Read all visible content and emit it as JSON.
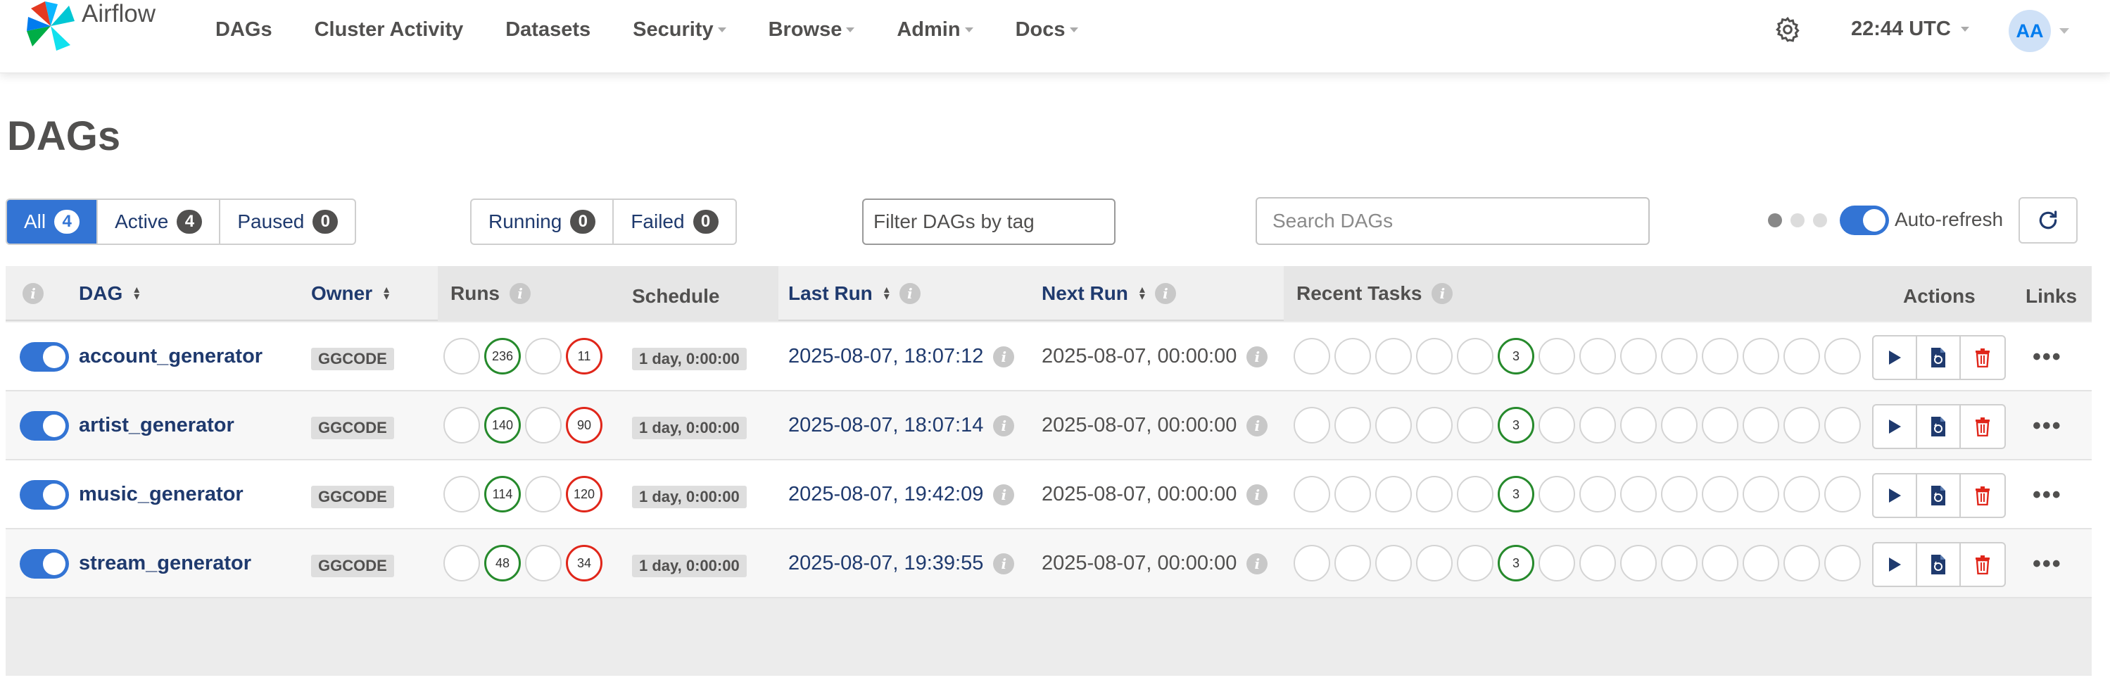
{
  "brand": {
    "name": "Airflow"
  },
  "nav": {
    "items": [
      {
        "label": "DAGs",
        "dropdown": false
      },
      {
        "label": "Cluster Activity",
        "dropdown": false
      },
      {
        "label": "Datasets",
        "dropdown": false
      },
      {
        "label": "Security",
        "dropdown": true
      },
      {
        "label": "Browse",
        "dropdown": true
      },
      {
        "label": "Admin",
        "dropdown": true
      },
      {
        "label": "Docs",
        "dropdown": true
      }
    ],
    "time": "22:44 UTC",
    "avatar_initials": "AA"
  },
  "page": {
    "title": "DAGs"
  },
  "filters": {
    "status": [
      {
        "label": "All",
        "count": "4",
        "active": true
      },
      {
        "label": "Active",
        "count": "4",
        "active": false
      },
      {
        "label": "Paused",
        "count": "0",
        "active": false
      }
    ],
    "state": [
      {
        "label": "Running",
        "count": "0"
      },
      {
        "label": "Failed",
        "count": "0"
      }
    ],
    "tag_placeholder": "Filter DAGs by tag",
    "search_placeholder": "Search DAGs",
    "auto_refresh_label": "Auto-refresh",
    "auto_refresh_on": true
  },
  "table": {
    "columns": {
      "dag": "DAG",
      "owner": "Owner",
      "runs": "Runs",
      "schedule": "Schedule",
      "last_run": "Last Run",
      "next_run": "Next Run",
      "recent_tasks": "Recent Tasks",
      "actions": "Actions",
      "links": "Links"
    },
    "rows": [
      {
        "dag_id": "account_generator",
        "owner": "GGCODE",
        "runs_success": "236",
        "runs_failed": "11",
        "schedule": "1 day, 0:00:00",
        "last_run": "2025-08-07, 18:07:12",
        "next_run": "2025-08-07, 00:00:00",
        "recent_success": "3",
        "enabled": true
      },
      {
        "dag_id": "artist_generator",
        "owner": "GGCODE",
        "runs_success": "140",
        "runs_failed": "90",
        "schedule": "1 day, 0:00:00",
        "last_run": "2025-08-07, 18:07:14",
        "next_run": "2025-08-07, 00:00:00",
        "recent_success": "3",
        "enabled": true
      },
      {
        "dag_id": "music_generator",
        "owner": "GGCODE",
        "runs_success": "114",
        "runs_failed": "120",
        "schedule": "1 day, 0:00:00",
        "last_run": "2025-08-07, 19:42:09",
        "next_run": "2025-08-07, 00:00:00",
        "recent_success": "3",
        "enabled": true
      },
      {
        "dag_id": "stream_generator",
        "owner": "GGCODE",
        "runs_success": "48",
        "runs_failed": "34",
        "schedule": "1 day, 0:00:00",
        "last_run": "2025-08-07, 19:39:55",
        "next_run": "2025-08-07, 00:00:00",
        "recent_success": "3",
        "enabled": true
      }
    ],
    "more_label": "•••"
  },
  "icons": {
    "settings": "gear-icon",
    "refresh": "refresh-icon",
    "trigger": "play-icon",
    "reparse": "reparse-file-icon",
    "delete": "trash-icon",
    "info": "info-icon"
  },
  "colors": {
    "primary": "#3374d4",
    "link": "#1f3a6e",
    "success": "#268a2c",
    "failed": "#e0261a",
    "delete": "#e0261a"
  }
}
